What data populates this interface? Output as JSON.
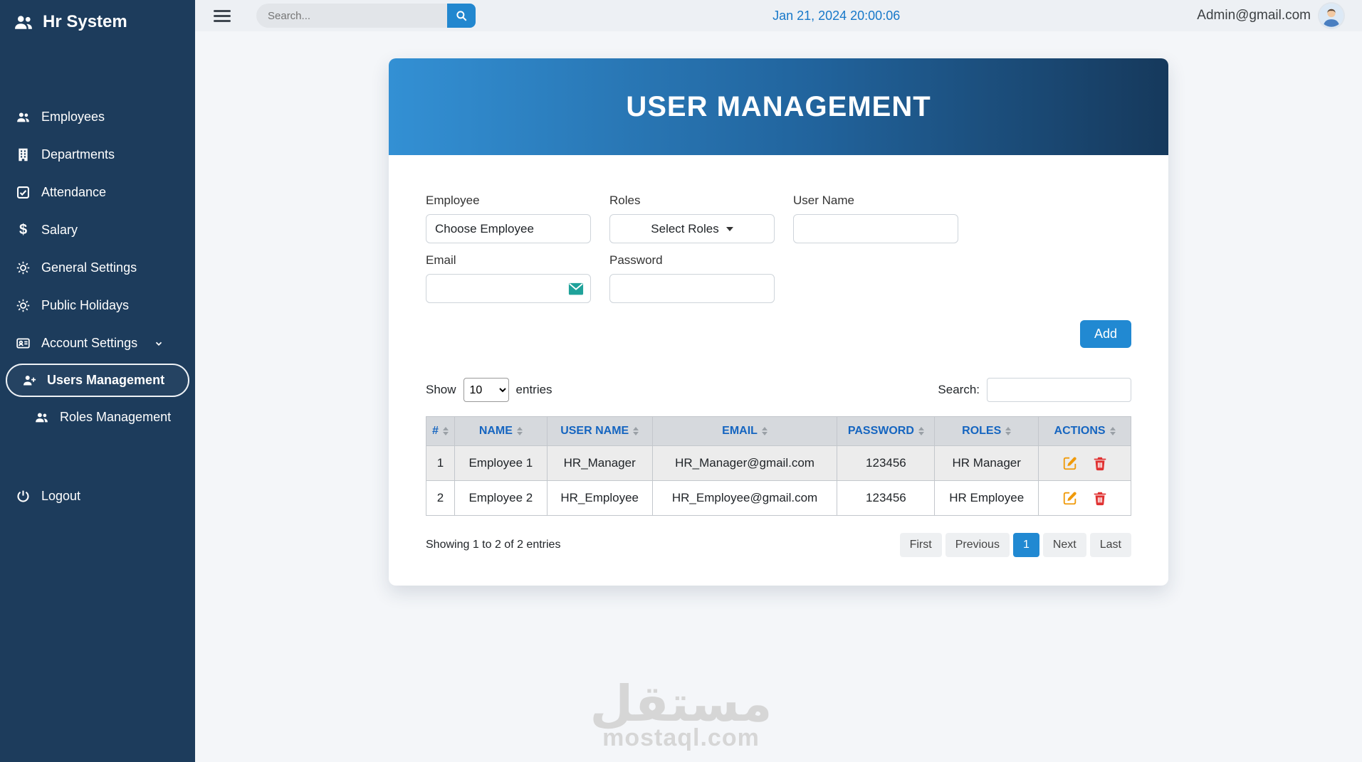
{
  "app": {
    "title": "Hr System"
  },
  "topbar": {
    "search_placeholder": "Search...",
    "datetime": "Jan 21, 2024 20:00:06",
    "user_email": "Admin@gmail.com"
  },
  "sidebar": {
    "items": [
      {
        "label": "Employees",
        "icon": "people-icon"
      },
      {
        "label": "Departments",
        "icon": "building-icon"
      },
      {
        "label": "Attendance",
        "icon": "check-square-icon"
      },
      {
        "label": "Salary",
        "icon": "dollar-icon"
      },
      {
        "label": "General Settings",
        "icon": "gear-icon"
      },
      {
        "label": "Public Holidays",
        "icon": "gear-icon"
      },
      {
        "label": "Account Settings",
        "icon": "card-icon"
      }
    ],
    "account_children": [
      {
        "label": "Users Management",
        "icon": "user-plus-icon",
        "active": true
      },
      {
        "label": "Roles Management",
        "icon": "people-icon",
        "active": false
      }
    ],
    "logout_label": "Logout"
  },
  "page": {
    "title": "USER MANAGEMENT",
    "form": {
      "employee_label": "Employee",
      "employee_placeholder": "Choose Employee",
      "roles_label": "Roles",
      "roles_button": "Select Roles",
      "username_label": "User Name",
      "email_label": "Email",
      "password_label": "Password",
      "add_button": "Add"
    },
    "table_controls": {
      "show_label": "Show",
      "page_size": "10",
      "entries_label": "entries",
      "search_label": "Search:"
    },
    "table": {
      "headers": [
        "#",
        "NAME",
        "USER NAME",
        "EMAIL",
        "PASSWORD",
        "ROLES",
        "ACTIONS"
      ],
      "rows": [
        {
          "num": "1",
          "name": "Employee 1",
          "username": "HR_Manager",
          "email": "HR_Manager@gmail.com",
          "password": "123456",
          "roles": "HR Manager"
        },
        {
          "num": "2",
          "name": "Employee 2",
          "username": "HR_Employee",
          "email": "HR_Employee@gmail.com",
          "password": "123456",
          "roles": "HR Employee"
        }
      ]
    },
    "footer": {
      "showing_text": "Showing 1 to 2 of 2 entries",
      "pagination": [
        "First",
        "Previous",
        "1",
        "Next",
        "Last"
      ],
      "active_page": "1"
    }
  },
  "watermark": {
    "arabic": "مستقل",
    "latin": "mostaql.com"
  },
  "colors": {
    "sidebar_bg": "#1d3c5c",
    "accent_blue": "#2189d2",
    "header_gradient_start": "#3390d4",
    "header_gradient_end": "#16395c",
    "table_header_text": "#1565c0",
    "datetime_text": "#1778c9",
    "edit_icon": "#f09a0a",
    "delete_icon": "#e03131",
    "email_icon": "#1fa29a"
  }
}
